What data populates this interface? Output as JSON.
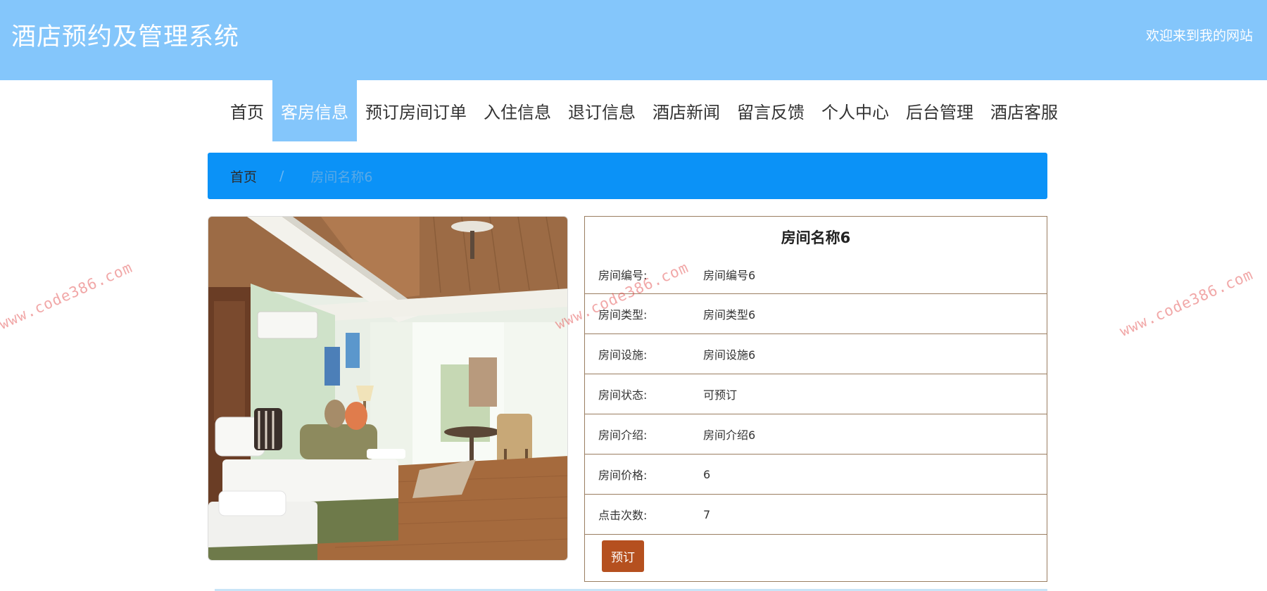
{
  "header": {
    "title": "酒店预约及管理系统",
    "welcome": "欢迎来到我的网站"
  },
  "nav": {
    "items": [
      {
        "label": "首页"
      },
      {
        "label": "客房信息"
      },
      {
        "label": "预订房间订单"
      },
      {
        "label": "入住信息"
      },
      {
        "label": "退订信息"
      },
      {
        "label": "酒店新闻"
      },
      {
        "label": "留言反馈"
      },
      {
        "label": "个人中心"
      },
      {
        "label": "后台管理"
      },
      {
        "label": "酒店客服"
      }
    ],
    "active_index": 1
  },
  "breadcrumb": {
    "home": "首页",
    "separator": "/",
    "current": "房间名称6"
  },
  "room": {
    "name": "房间名称6",
    "rows": [
      {
        "label": "房间编号:",
        "value": "房间编号6"
      },
      {
        "label": "房间类型:",
        "value": "房间类型6"
      },
      {
        "label": "房间设施:",
        "value": "房间设施6"
      },
      {
        "label": "房间状态:",
        "value": "可预订"
      },
      {
        "label": "房间介绍:",
        "value": "房间介绍6"
      },
      {
        "label": "房间价格:",
        "value": "6"
      },
      {
        "label": "点击次数:",
        "value": "7"
      }
    ],
    "book_label": "预订"
  },
  "watermark": {
    "text": "www.code386.com"
  },
  "colors": {
    "header_bg": "#84c6fb",
    "breadcrumb_bg": "#0b92f7",
    "button_bg": "#b5501f",
    "table_border": "#9a7e61"
  }
}
